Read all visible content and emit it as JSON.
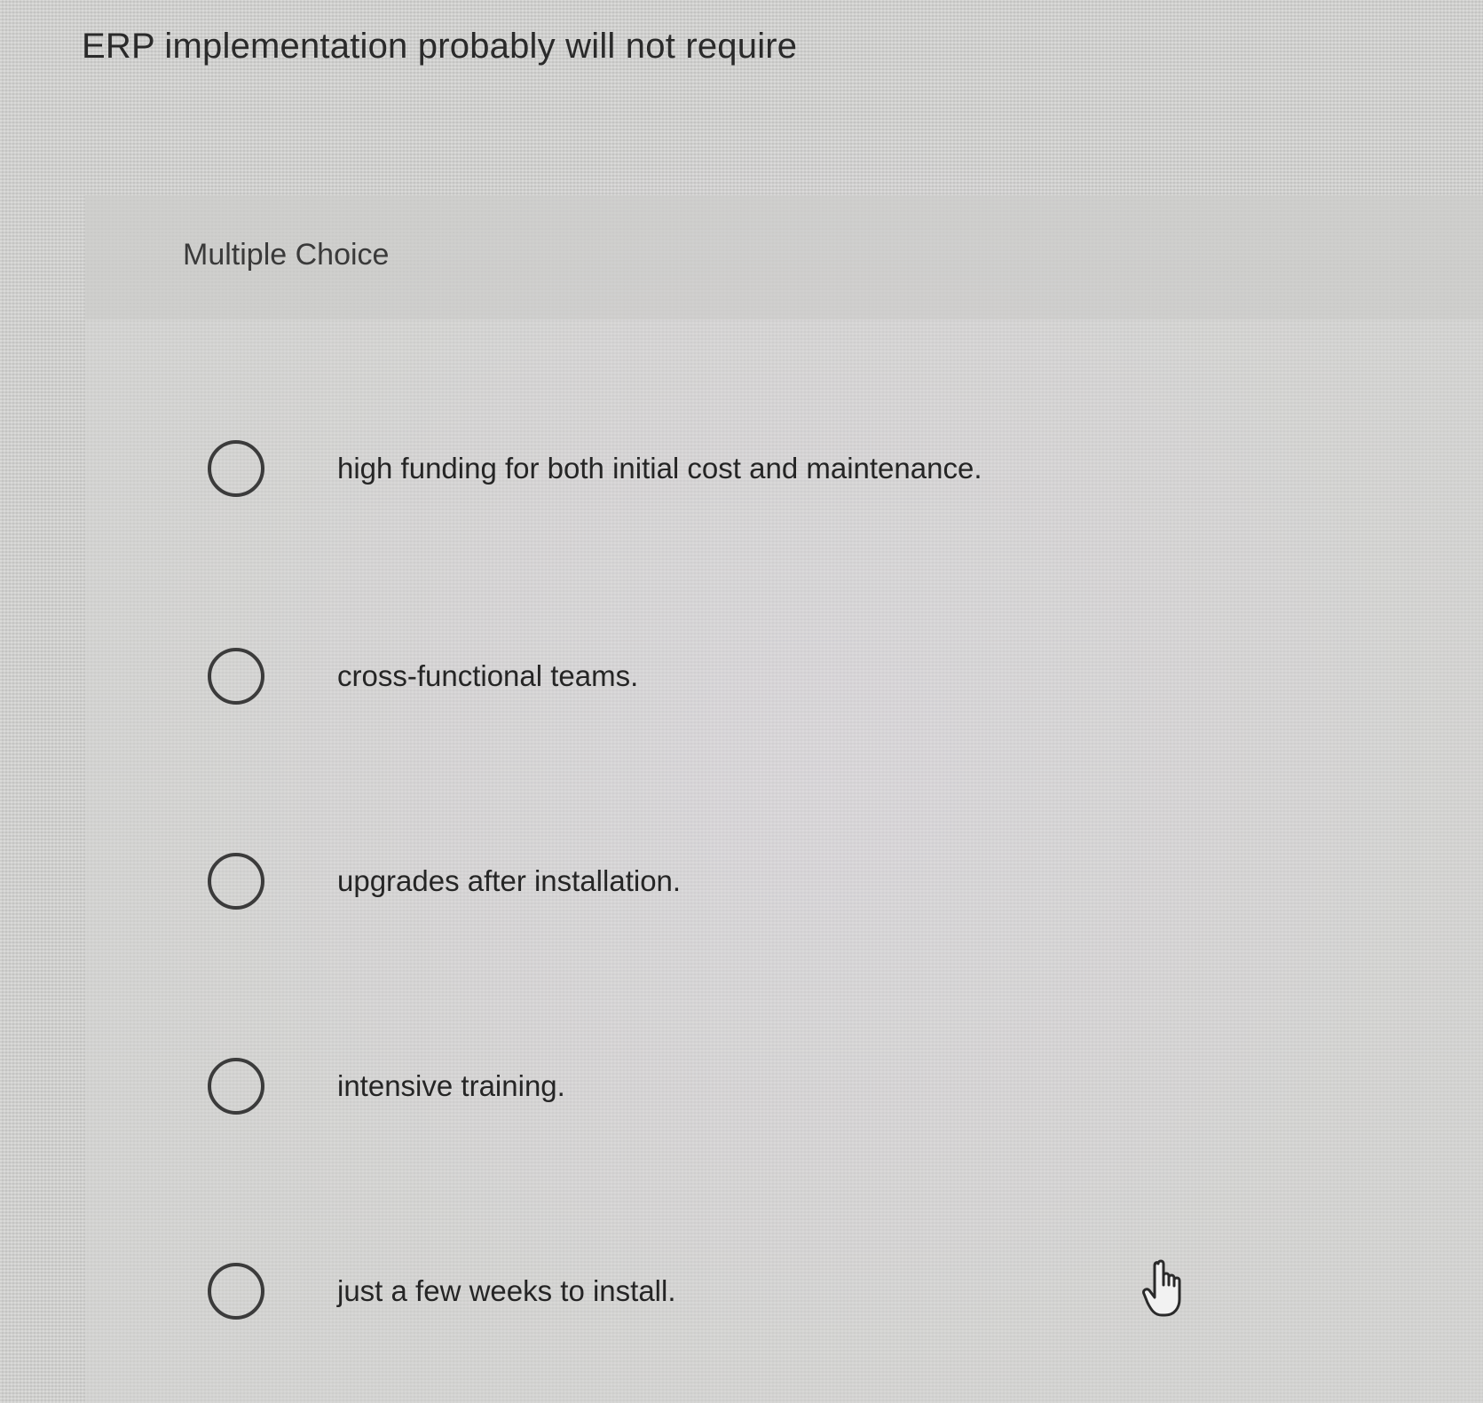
{
  "question": {
    "text": "ERP implementation probably will not require"
  },
  "question_type": {
    "label": "Multiple Choice"
  },
  "options": [
    {
      "label": "high funding for both initial cost and maintenance.",
      "selected": false
    },
    {
      "label": "cross-functional teams.",
      "selected": false
    },
    {
      "label": "upgrades after installation.",
      "selected": false
    },
    {
      "label": "intensive training.",
      "selected": false
    },
    {
      "label": "just a few weeks to install.",
      "selected": false
    }
  ],
  "cursor": {
    "icon": "hand-pointer-icon"
  }
}
